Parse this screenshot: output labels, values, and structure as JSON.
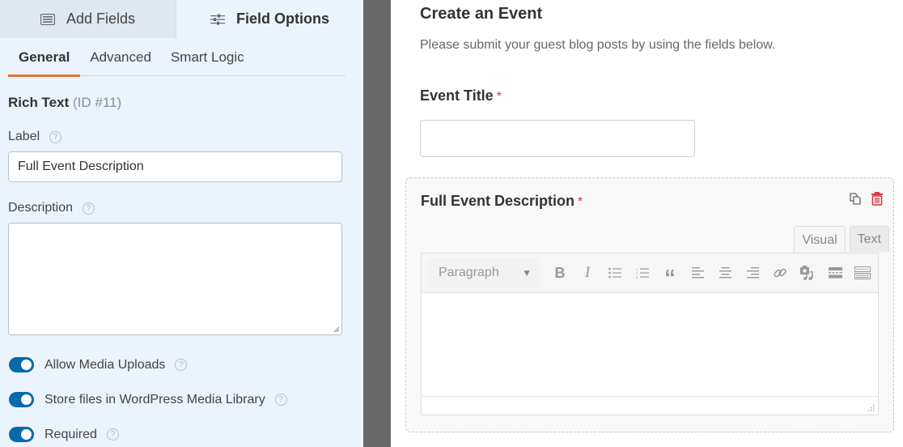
{
  "left_panel": {
    "top_tabs": [
      {
        "label": "Add Fields",
        "icon": "list-icon",
        "active": false
      },
      {
        "label": "Field Options",
        "icon": "sliders-icon",
        "active": true
      }
    ],
    "sub_tabs": [
      {
        "label": "General",
        "active": true
      },
      {
        "label": "Advanced",
        "active": false
      },
      {
        "label": "Smart Logic",
        "active": false
      }
    ],
    "section": {
      "title": "Rich Text",
      "id_text": "(ID #11)"
    },
    "label_field": {
      "label": "Label",
      "value": "Full Event Description",
      "help": "?"
    },
    "description_field": {
      "label": "Description",
      "value": "",
      "help": "?"
    },
    "toggles": [
      {
        "label": "Allow Media Uploads",
        "on": true,
        "help": "?"
      },
      {
        "label": "Store files in WordPress Media Library",
        "on": true,
        "help": "?"
      },
      {
        "label": "Required",
        "on": true,
        "help": "?"
      }
    ],
    "colors": {
      "accent_tab": "#e27730",
      "toggle_on": "#056aab"
    }
  },
  "preview": {
    "form_title": "Create an Event",
    "form_description": "Please submit your guest blog posts by using the fields below.",
    "fields": [
      {
        "label": "Event Title",
        "required_mark": "*",
        "value": ""
      },
      {
        "label": "Full Event Description",
        "required_mark": "*",
        "selected": true
      }
    ],
    "field_actions": [
      {
        "name": "duplicate-icon"
      },
      {
        "name": "trash-icon",
        "color": "#d63638"
      }
    ],
    "editor": {
      "tabs": [
        {
          "label": "Visual",
          "active": true
        },
        {
          "label": "Text",
          "active": false
        }
      ],
      "format_select": "Paragraph",
      "toolbar": [
        "bold-icon",
        "italic-icon",
        "bullet-list-icon",
        "numbered-list-icon",
        "blockquote-icon",
        "align-left-icon",
        "align-center-icon",
        "align-right-icon",
        "link-icon",
        "add-media-icon",
        "read-more-icon",
        "toolbar-toggle-icon"
      ],
      "toolbar_labels": {
        "bold": "B",
        "italic": "I",
        "quote": "“"
      }
    }
  }
}
